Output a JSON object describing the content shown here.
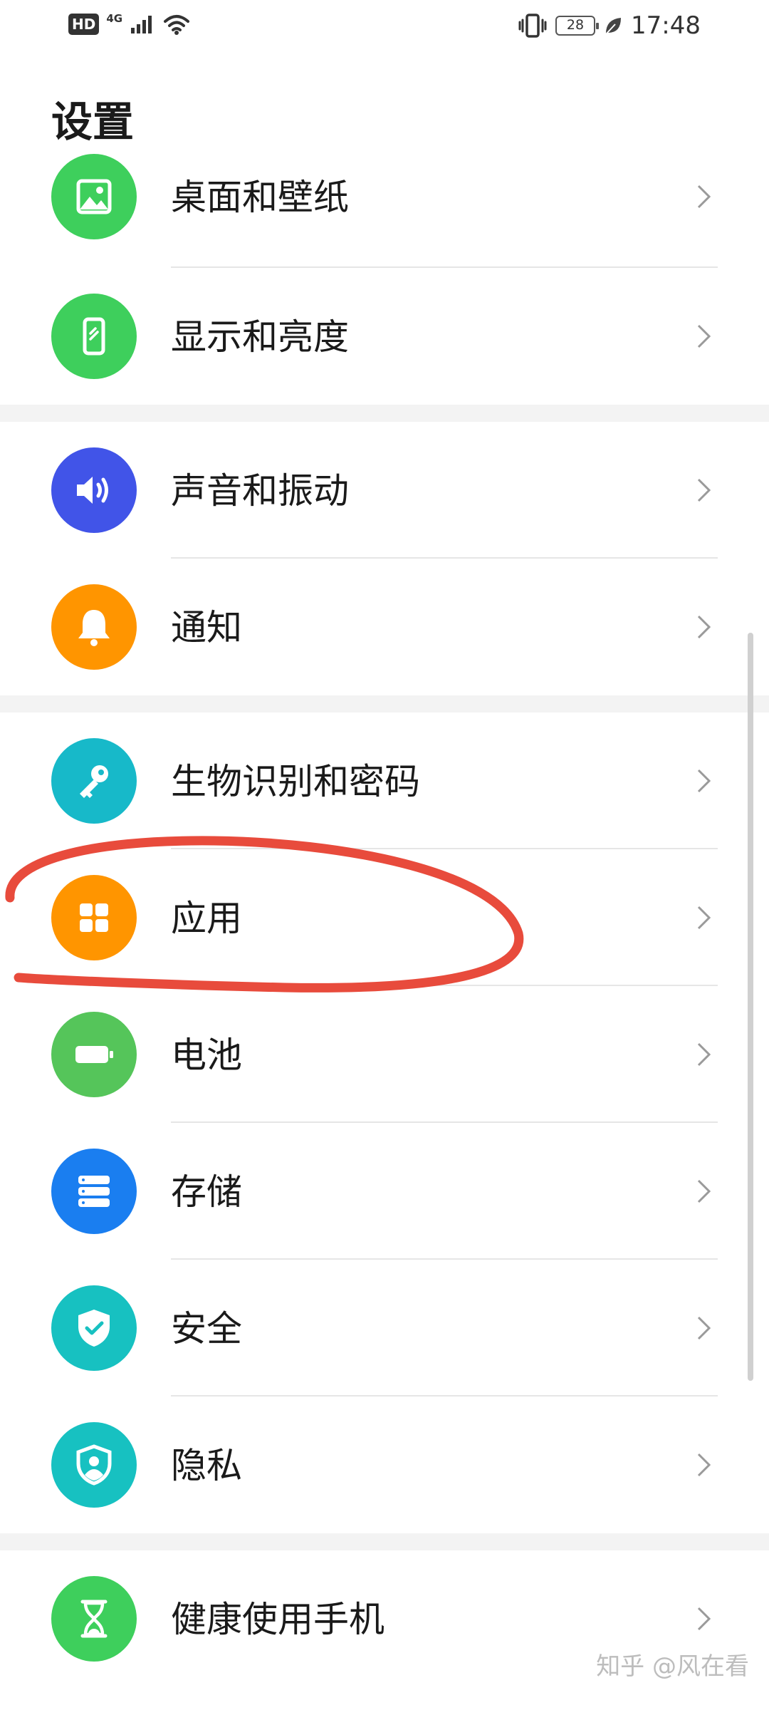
{
  "status_bar": {
    "hd": "HD",
    "network": "4G",
    "battery": "28",
    "time": "17:48",
    "icons": [
      "signal-icon",
      "wifi-icon",
      "vibrate-icon",
      "leaf-icon"
    ]
  },
  "title": "设置",
  "groups": [
    [
      {
        "label": "桌面和壁纸",
        "icon": "wallpaper-icon",
        "color": "#3ecf5c"
      },
      {
        "label": "显示和亮度",
        "icon": "display-icon",
        "color": "#3ecf5c"
      }
    ],
    [
      {
        "label": "声音和振动",
        "icon": "sound-icon",
        "color": "#4154e8"
      },
      {
        "label": "通知",
        "icon": "bell-icon",
        "color": "#ff9500"
      }
    ],
    [
      {
        "label": "生物识别和密码",
        "icon": "key-icon",
        "color": "#17b9c9"
      },
      {
        "label": "应用",
        "icon": "apps-icon",
        "color": "#ff9500"
      },
      {
        "label": "电池",
        "icon": "battery-icon",
        "color": "#55c55a"
      },
      {
        "label": "存储",
        "icon": "storage-icon",
        "color": "#1a7ef0"
      },
      {
        "label": "安全",
        "icon": "shield-icon",
        "color": "#17c1c1"
      },
      {
        "label": "隐私",
        "icon": "privacy-icon",
        "color": "#17c1c1"
      }
    ],
    [
      {
        "label": "健康使用手机",
        "icon": "hourglass-icon",
        "color": "#3ecf5c"
      }
    ]
  ],
  "annotation_color": "#e84b3c",
  "watermark": "知乎 @风在看"
}
